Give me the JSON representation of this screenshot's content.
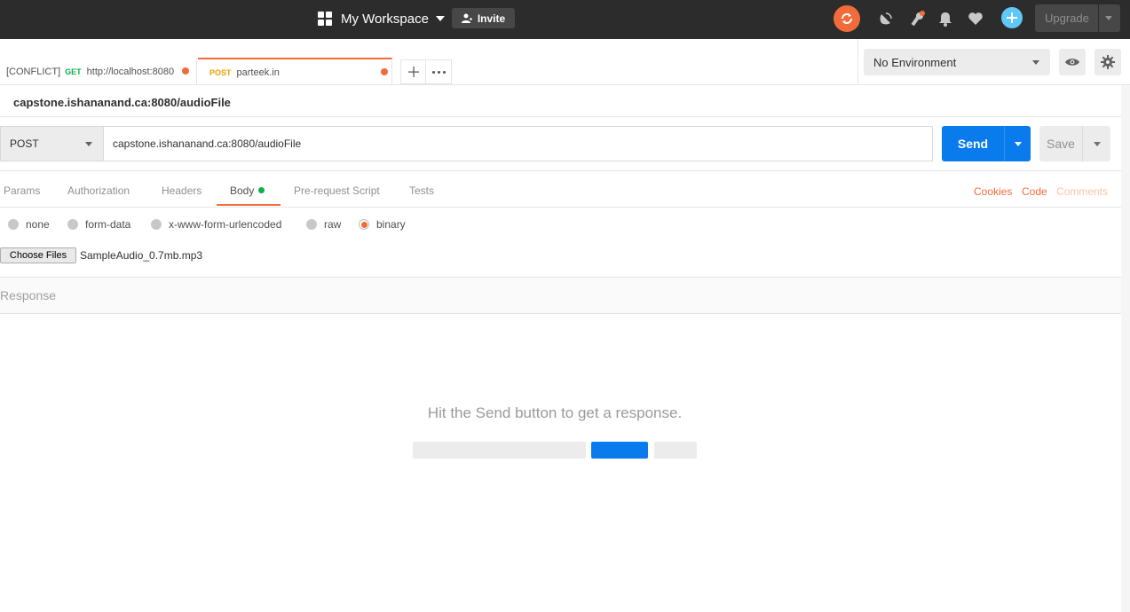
{
  "header": {
    "workspace_label": "My Workspace",
    "invite_label": "Invite",
    "upgrade_label": "Upgrade",
    "colors": {
      "bar": "#2c2c2c",
      "sync": "#f26b3a",
      "add": "#5fc8f8"
    }
  },
  "tabs": [
    {
      "conflict_tag": "[CONFLICT]",
      "method": "GET",
      "label": "http://localhost:8080",
      "unsaved": true
    },
    {
      "method": "POST",
      "label": "parteek.in",
      "unsaved": true,
      "active": true
    }
  ],
  "environment": {
    "selected": "No Environment"
  },
  "request": {
    "title": "capstone.ishananand.ca:8080/audioFile",
    "method": "POST",
    "url": "capstone.ishananand.ca:8080/audioFile",
    "send_label": "Send",
    "save_label": "Save"
  },
  "subtabs": {
    "params": "Params",
    "authorization": "Authorization",
    "headers": "Headers",
    "body": "Body",
    "prerequest": "Pre-request Script",
    "tests": "Tests",
    "active": "Body"
  },
  "links": {
    "cookies": "Cookies",
    "code": "Code",
    "comments": "Comments"
  },
  "body": {
    "modes": [
      "none",
      "form-data",
      "x-www-form-urlencoded",
      "raw",
      "binary"
    ],
    "selected_mode": "binary",
    "choose_label": "Choose Files",
    "file_name": "SampleAudio_0.7mb.mp3"
  },
  "response": {
    "label": "Response",
    "hint": "Hit the Send button to get a response."
  },
  "accent": {
    "orange": "#f26b3a",
    "blue": "#097bed",
    "green": "#0cb04a"
  }
}
